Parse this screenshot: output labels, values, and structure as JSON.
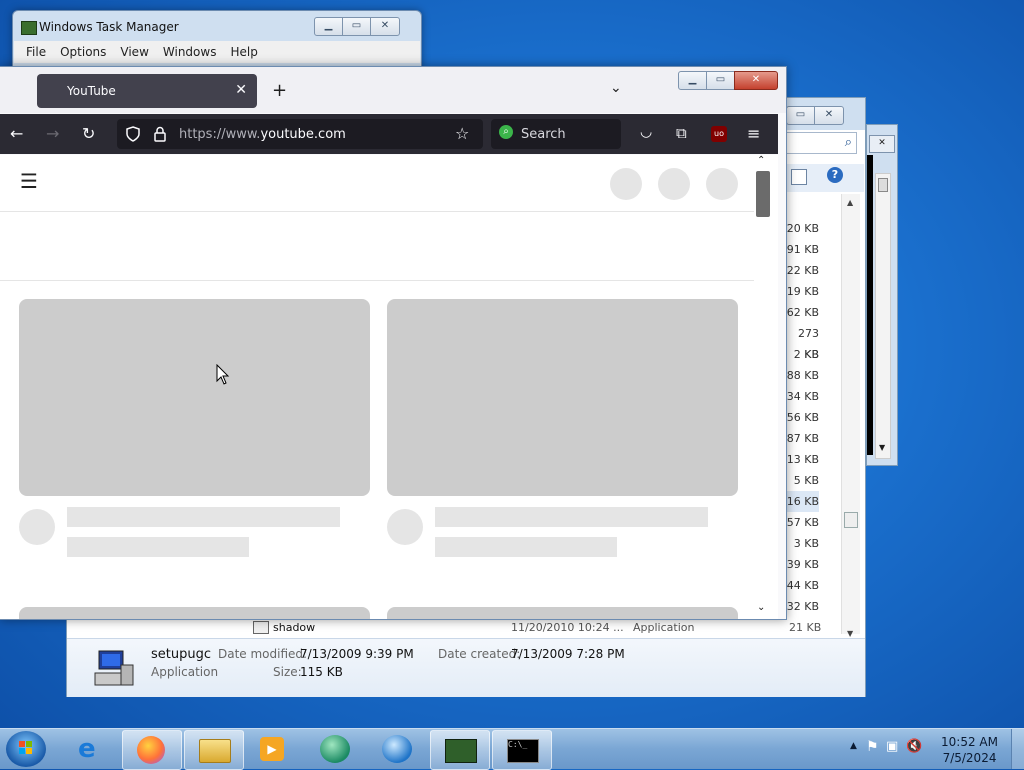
{
  "taskmgr": {
    "title": "Windows Task Manager",
    "menu": [
      "File",
      "Options",
      "View",
      "Windows",
      "Help"
    ]
  },
  "explorer": {
    "sizes": [
      "20 KB",
      "91 KB",
      "22 KB",
      "19 KB",
      "62 KB",
      "273 KB",
      "2 KB",
      "88 KB",
      "34 KB",
      "56 KB",
      "87 KB",
      "13 KB",
      "5 KB",
      "16 KB",
      "57 KB",
      "3 KB",
      "39 KB",
      "44 KB",
      "32 KB"
    ],
    "selected_index": 13,
    "visible_row": {
      "name": "shadow",
      "date": "11/20/2010 10:24 ...",
      "type": "Application",
      "size": "21 KB"
    },
    "details": {
      "name": "setupugc",
      "type": "Application",
      "modified_label": "Date modified:",
      "modified_value": "7/13/2009 9:39 PM",
      "created_label": "Date created:",
      "created_value": "7/13/2009 7:28 PM",
      "size_label": "Size:",
      "size_value": "115 KB"
    }
  },
  "firefox": {
    "tab_title": "YouTube",
    "url_prefix": "https://www.",
    "url_domain": "youtube.com",
    "search_placeholder": "Search"
  },
  "taskbar": {
    "time": "10:52 AM",
    "date": "7/5/2024"
  },
  "colors": {
    "firefox_dark": "#2b2a33",
    "skeleton_thumb": "#cccccc",
    "skeleton_line": "#e5e5e5"
  }
}
